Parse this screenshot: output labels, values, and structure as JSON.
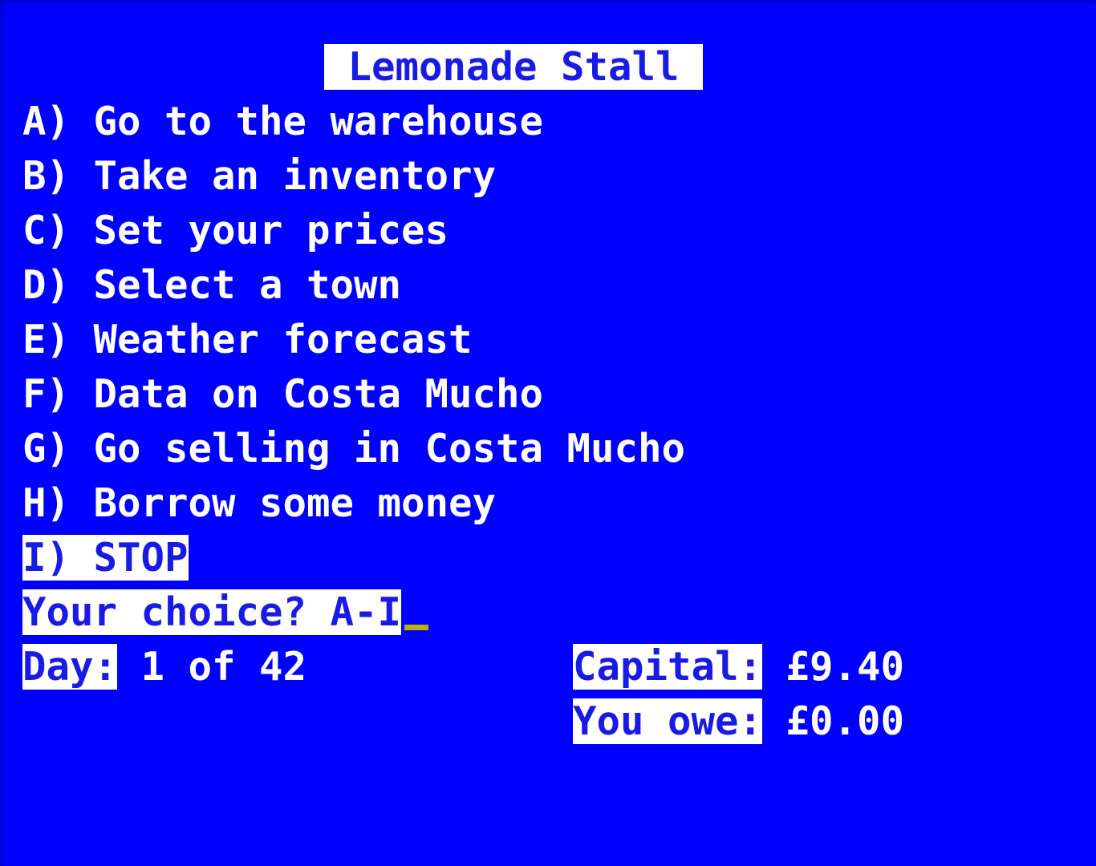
{
  "screen": {
    "background_color": "#0000ff",
    "text_color": "#ffffff",
    "inverse_text_color": "#1a1ae6",
    "inverse_background_color": "#ffffff",
    "cursor_color": "#c0b000"
  },
  "title": {
    "text": " Lemonade Stall ",
    "style": "inverse"
  },
  "menu": {
    "items": [
      {
        "key": "A",
        "label": "A) Go to the warehouse",
        "style": "normal"
      },
      {
        "key": "B",
        "label": "B) Take an inventory",
        "style": "normal"
      },
      {
        "key": "C",
        "label": "C) Set your prices",
        "style": "normal"
      },
      {
        "key": "D",
        "label": "D) Select a town",
        "style": "normal"
      },
      {
        "key": "E",
        "label": "E) Weather forecast",
        "style": "normal"
      },
      {
        "key": "F",
        "label": "F) Data on Costa Mucho",
        "style": "normal"
      },
      {
        "key": "G",
        "label": "G) Go selling in Costa Mucho",
        "style": "normal"
      },
      {
        "key": "H",
        "label": "H) Borrow some money",
        "style": "normal"
      },
      {
        "key": "I",
        "label": "I) STOP",
        "style": "inverse"
      }
    ]
  },
  "prompt": {
    "label": "Your choice? A-I",
    "value": "",
    "placeholder": "A-I",
    "style": "inverse",
    "cursor_visible": true
  },
  "status": {
    "day": {
      "label": "Day:",
      "value": " 1 of 42"
    },
    "capital": {
      "label": "Capital:",
      "value": " £9.40"
    },
    "owed": {
      "label": "You owe:",
      "value": " £0.00"
    }
  }
}
